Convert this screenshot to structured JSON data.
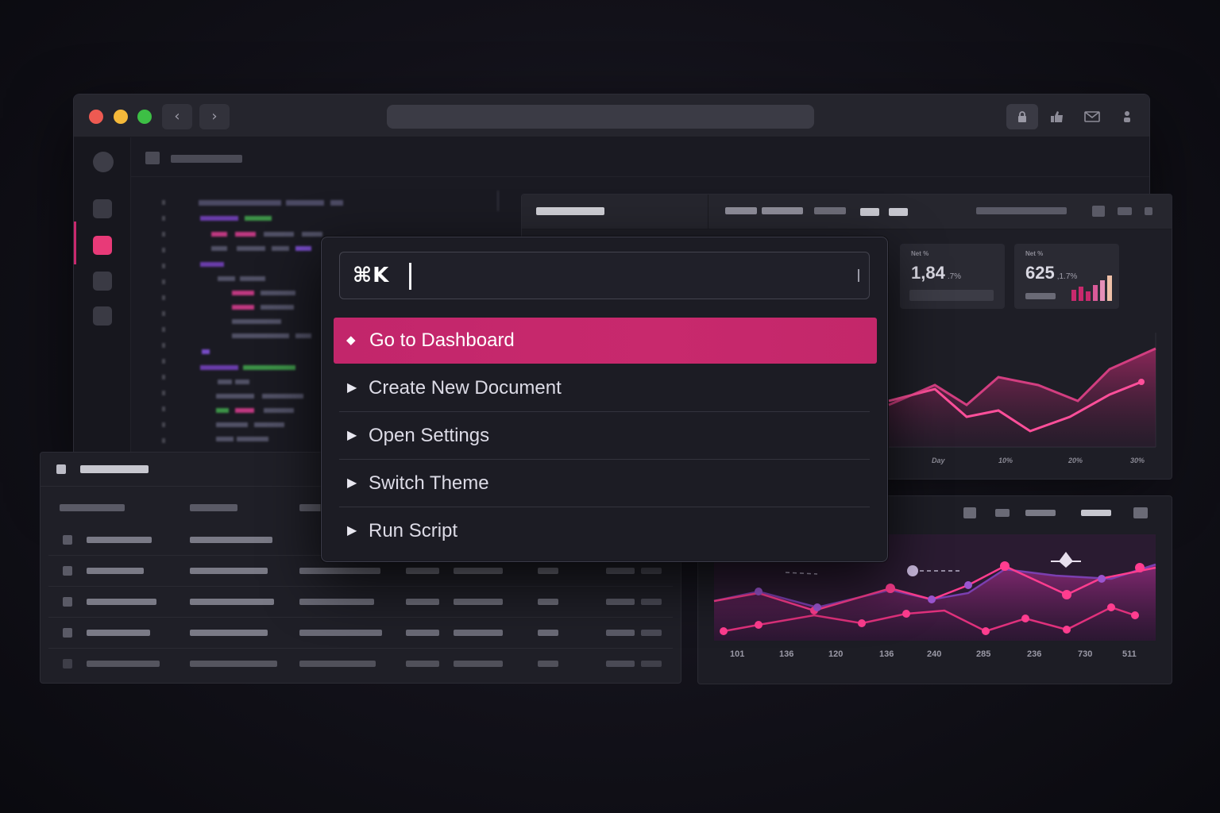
{
  "palette": {
    "shortcut": "⌘K",
    "search": {
      "value": "",
      "placeholder": ""
    },
    "items": [
      {
        "label": "Go to Dashboard",
        "icon": "diamond-icon",
        "active": true
      },
      {
        "label": "Create New Document",
        "icon": "play-icon",
        "active": false
      },
      {
        "label": "Open Settings",
        "icon": "play-icon",
        "active": false
      },
      {
        "label": "Switch Theme",
        "icon": "play-icon",
        "active": false
      },
      {
        "label": "Run Script",
        "icon": "play-icon",
        "active": false
      }
    ]
  },
  "dashboard": {
    "cards": [
      {
        "label": "Net %",
        "value": "1,84",
        "delta": ".7%"
      },
      {
        "label": "Net %",
        "value": "625",
        "delta": ",1.7%"
      }
    ],
    "chart1_ticks": [
      "Day",
      "10%",
      "20%",
      "30%"
    ],
    "chart2_ticks": [
      "101",
      "136",
      "120",
      "136",
      "240",
      "285",
      "236",
      "730",
      "511"
    ]
  },
  "colors": {
    "accent": "#c8296d",
    "accent_bright": "#ff4f9a",
    "purple": "#7b3fb0",
    "window_bg": "#1a1a22",
    "page_bg": "#121119"
  },
  "window": {
    "traffic_lights": [
      "#ee5a52",
      "#f5b93a",
      "#3dbf45"
    ],
    "toolbar_icons": [
      "lock-icon",
      "thumbs-up-icon",
      "mail-icon",
      "person-icon"
    ]
  }
}
